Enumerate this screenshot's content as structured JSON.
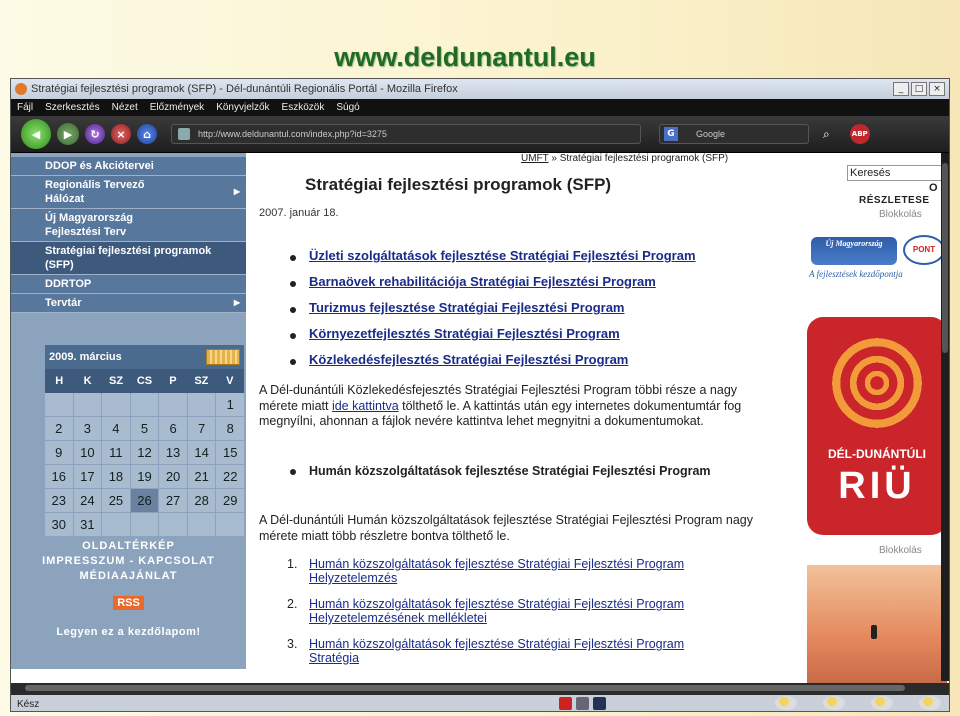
{
  "slide": {
    "title": "www.deldunantul.eu"
  },
  "window": {
    "title": "Stratégiai fejlesztési programok (SFP) - Dél-dunántúli Regionális Portál - Mozilla Firefox",
    "min": "_",
    "max": "□",
    "close": "×"
  },
  "menu": [
    "Fájl",
    "Szerkesztés",
    "Nézet",
    "Előzmények",
    "Könyvjelzők",
    "Eszközök",
    "Súgó"
  ],
  "toolbar": {
    "url": "http://www.deldunantul.com/index.php?id=3275",
    "search_placeholder": "Google",
    "abp": "ABP"
  },
  "sidebar": {
    "items": [
      {
        "label": "DDOP és Akciótervei",
        "arrow": ""
      },
      {
        "label": "Regionális Tervező Hálózat",
        "arrow": "▶"
      },
      {
        "label": "Új Magyarország Fejlesztési Terv",
        "arrow": ""
      },
      {
        "label": "Stratégiai fejlesztési programok (SFP)",
        "arrow": ""
      },
      {
        "label": "DDRTOP",
        "arrow": ""
      },
      {
        "label": "Tervtár",
        "arrow": "▶"
      }
    ],
    "calendar": {
      "month": "2009. március",
      "dows": [
        "H",
        "K",
        "SZ",
        "CS",
        "P",
        "SZ",
        "V"
      ],
      "days": [
        "",
        "",
        "",
        "",
        "",
        "",
        "1",
        "2",
        "3",
        "4",
        "5",
        "6",
        "7",
        "8",
        "9",
        "10",
        "11",
        "12",
        "13",
        "14",
        "15",
        "16",
        "17",
        "18",
        "19",
        "20",
        "21",
        "22",
        "23",
        "24",
        "25",
        "26",
        "27",
        "28",
        "29",
        "30",
        "31",
        "",
        "",
        "",
        "",
        ""
      ],
      "today": "26"
    },
    "footer": {
      "sitemap": "OLDALTÉRKÉP",
      "impressum": "IMPRESSZUM - KAPCSOLAT",
      "media": "MÉDIAAJÁNLAT",
      "rss": "RSS",
      "home": "Legyen ez a kezdőlapom!"
    }
  },
  "main": {
    "breadcrumb_link": "ÚMFT",
    "breadcrumb_rest": " » Stratégiai fejlesztési programok (SFP)",
    "title": "Stratégiai fejlesztési programok (SFP)",
    "date": "2007. január 18.",
    "bullets": [
      "Üzleti szolgáltatások fejlesztése Stratégiai Fejlesztési Program",
      "Barnaövek rehabilitációja Stratégiai Fejlesztési Program",
      "Turizmus fejlesztése Stratégiai Fejlesztési Program",
      "Környezetfejlesztés Stratégiai Fejlesztési Program",
      "Közlekedésfejlesztés Stratégiai Fejlesztési Program"
    ],
    "para1_a": "A Dél-dunántúli Közlekedésfejesztés Stratégiai Fejlesztési Program többi része a nagy mérete miatt ",
    "para1_link": "ide kattintva",
    "para1_b": "  tölthető le. A kattintás után egy internetes dokumentumtár fog megnyílni, ahonnan a fájlok nevére kattintva lehet megnyitni a dokumentumokat.",
    "human_bullet": "Humán közszolgáltatások fejlesztése Stratégiai Fejlesztési Program",
    "para2": "A Dél-dunántúli Humán közszolgáltatások fejlesztése Stratégiai Fejlesztési Program nagy mérete miatt több részletre bontva tölthető le.",
    "ol": [
      {
        "num": "1.",
        "text": "Humán közszolgáltatások fejlesztése Stratégiai Fejlesztési Program Helyzetelemzés"
      },
      {
        "num": "2.",
        "text": "Humán közszolgáltatások fejlesztése Stratégiai Fejlesztési Program Helyzetelemzésének mellékletei"
      },
      {
        "num": "3.",
        "text": "Humán közszolgáltatások fejlesztése Stratégiai Fejlesztési Program Stratégia"
      }
    ]
  },
  "right": {
    "search_value": "Keresés",
    "go": "O",
    "details": "RÉSZLETESE",
    "blokk1": "Blokkolás",
    "blokk2": "Blokkolás",
    "umft_logo": "Új Magyarország",
    "pont": "PONT",
    "umft_caption": "A fejlesztések kezdőpontja",
    "riu_line1": "DÉL-DUNÁNTÚLI",
    "riu_line2": "RIÜ"
  },
  "status": {
    "text": "Kész"
  }
}
